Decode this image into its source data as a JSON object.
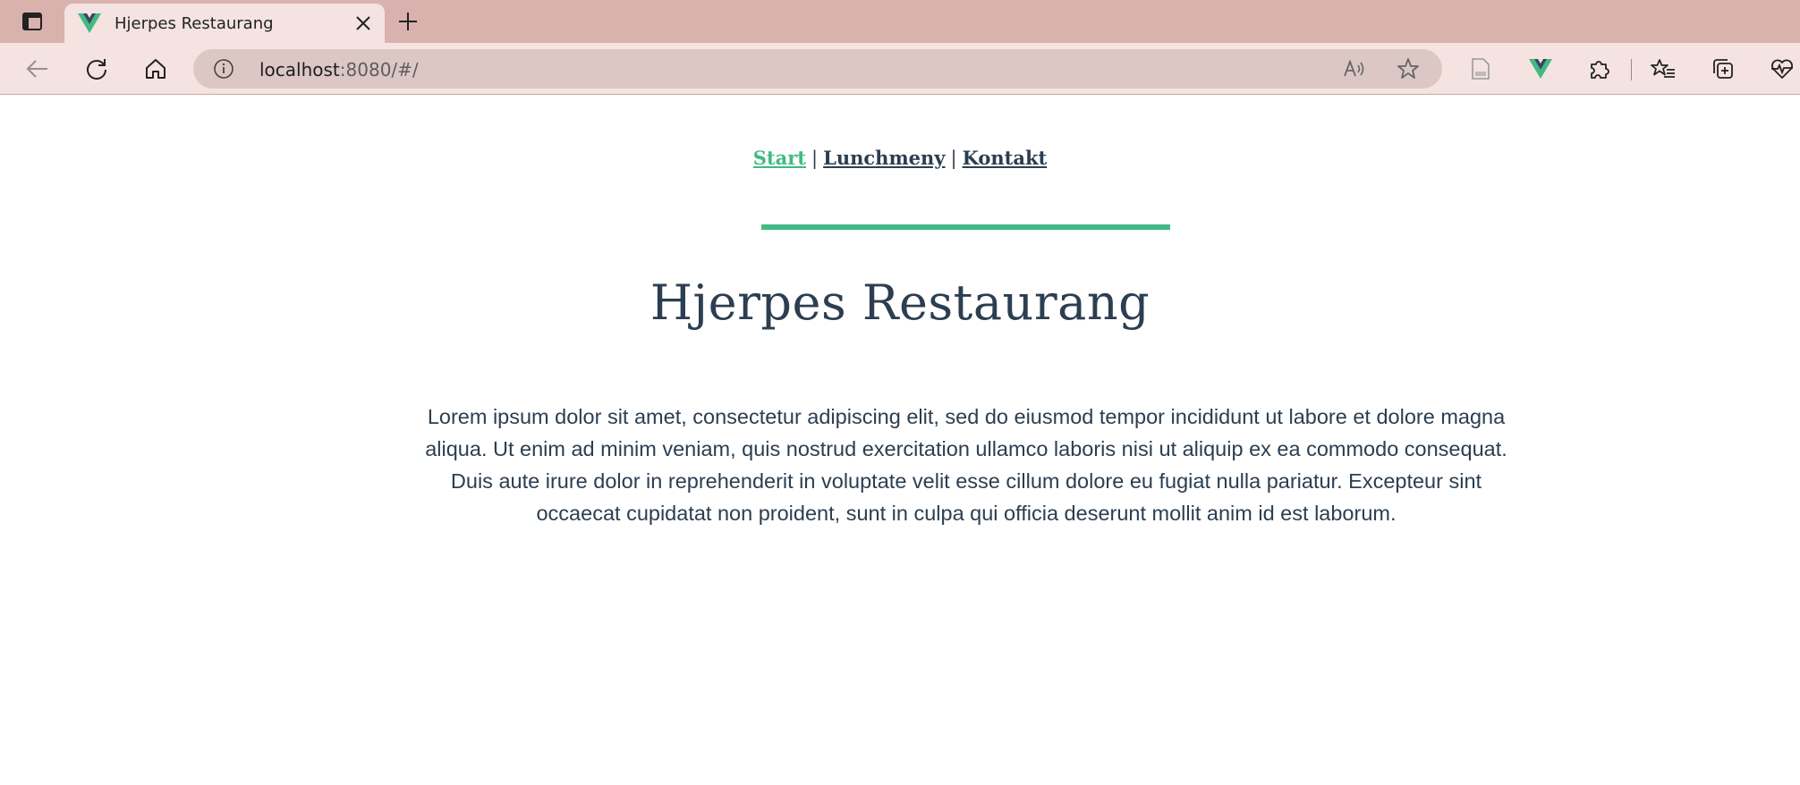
{
  "browser": {
    "tab": {
      "title": "Hjerpes Restaurang",
      "favicon": "vue-logo-icon"
    },
    "address": {
      "host": "localhost",
      "rest": ":8080/#/"
    },
    "icons": {
      "tab_actions": "tab-actions-icon",
      "close": "close-icon",
      "new_tab": "plus-icon",
      "back": "back-arrow-icon",
      "refresh": "refresh-icon",
      "home": "home-icon",
      "site_info": "info-icon",
      "read_aloud": "read-aloud-icon",
      "favorite": "star-icon",
      "reader": "reader-view-icon",
      "vue_devtools": "vue-devtools-icon",
      "extensions": "puzzle-icon",
      "favorites": "favorites-list-icon",
      "collections": "collections-icon",
      "browser_essentials": "heart-pulse-icon"
    },
    "colors": {
      "tabstrip": "#d9b2ad",
      "toolbar": "#f4e3e1",
      "addressbar": "#dcc7c5"
    }
  },
  "nav": {
    "items": [
      {
        "label": "Start",
        "active": true
      },
      {
        "label": "Lunchmeny",
        "active": false
      },
      {
        "label": "Kontakt",
        "active": false
      }
    ],
    "separator": "|"
  },
  "main": {
    "title": "Hjerpes Restaurang",
    "intro": "Lorem ipsum dolor sit amet, consectetur adipiscing elit, sed do eiusmod tempor incididunt ut labore et dolore magna aliqua. Ut enim ad minim veniam, quis nostrud exercitation ullamco laboris nisi ut aliquip ex ea commodo consequat. Duis aute irure dolor in reprehenderit in voluptate velit esse cillum dolore eu fugiat nulla pariatur. Excepteur sint occaecat cupidatat non proident, sunt in culpa qui officia deserunt mollit anim id est laborum."
  },
  "colors": {
    "accent": "#42b983",
    "text": "#2c3e50"
  }
}
